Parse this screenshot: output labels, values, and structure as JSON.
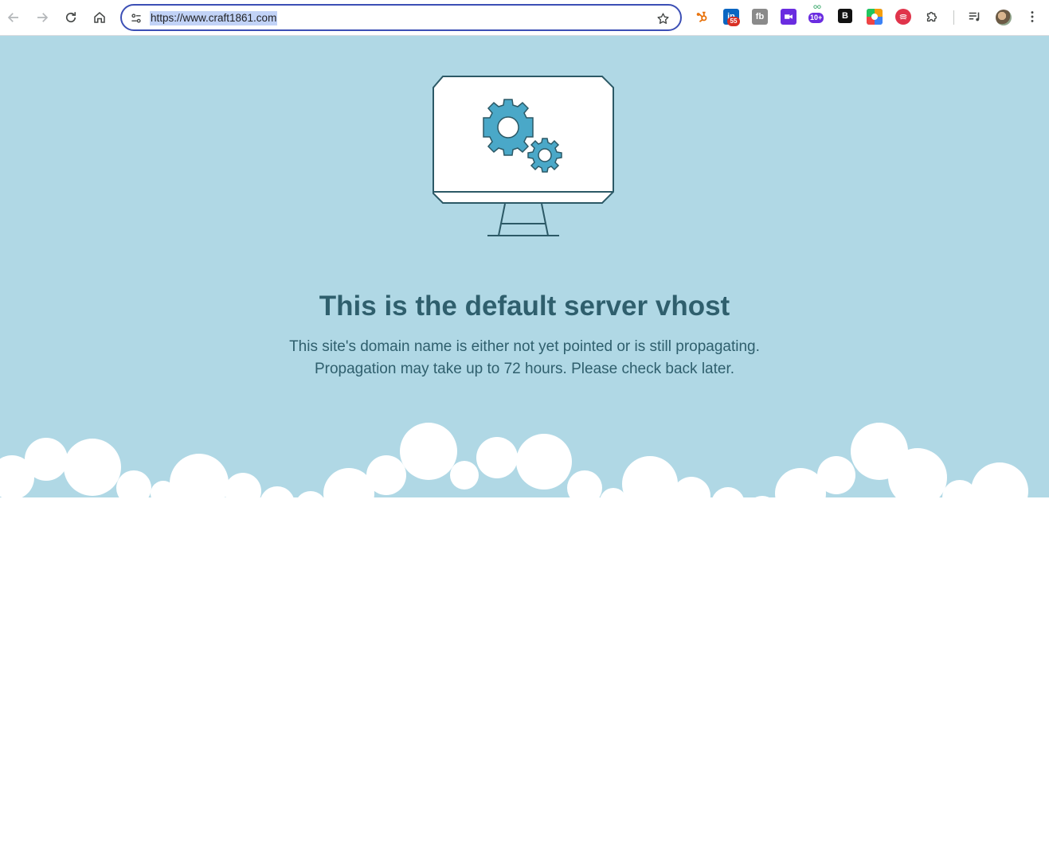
{
  "browser": {
    "url": "https://www.craft1861.com",
    "extensions": [
      {
        "name": "hubspot",
        "color": "#e8710a"
      },
      {
        "name": "linkedin-helper",
        "color": "#0a66c2",
        "badge": "55",
        "badge_color": "#d93025"
      },
      {
        "name": "fb-extension",
        "color": "#8a8a8a"
      },
      {
        "name": "video-extension",
        "color": "#6a2ce0"
      },
      {
        "name": "team-extension",
        "color": "#6a4bd6",
        "badge": "10+",
        "badge_color": "#6a2ce0"
      },
      {
        "name": "b-extension",
        "color": "#111111"
      },
      {
        "name": "color-extension",
        "color": "#3b82f6"
      },
      {
        "name": "red-extension",
        "color": "#e0344b"
      }
    ]
  },
  "page": {
    "headline": "This is the default server vhost",
    "line1": "This site's domain name is either not yet pointed or is still propagating.",
    "line2": "Propagation may take up to 72 hours. Please check back later.",
    "colors": {
      "sky": "#b0d8e5",
      "text": "#2f5f6d",
      "gear": "#4aa8c8",
      "outline": "#2c5966"
    }
  }
}
